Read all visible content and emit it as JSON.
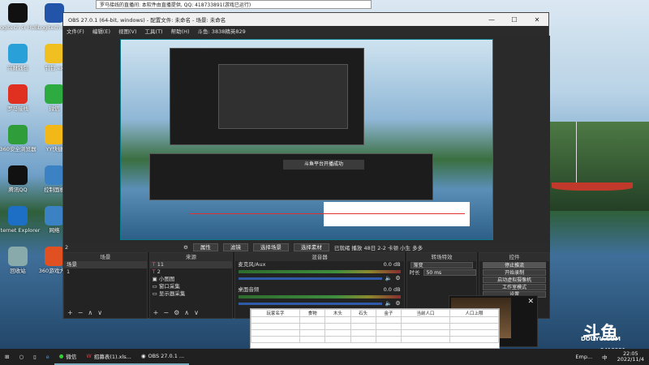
{
  "desktop": {
    "icons": [
      {
        "label": "Logitech G HUB",
        "color": "#111"
      },
      {
        "label": "Logitech G...",
        "color": "#2255aa"
      },
      {
        "label": "兴财钱包",
        "color": "#2aa0d8"
      },
      {
        "label": "钉钉.ex",
        "color": "#f0c020"
      },
      {
        "label": "罗马接线",
        "color": "#e03020"
      },
      {
        "label": "微信",
        "color": "#2daa40"
      },
      {
        "label": "360安全浏览器",
        "color": "#2f9e3a"
      },
      {
        "label": "YY快捷",
        "color": "#f2b818"
      },
      {
        "label": "腾讯QQ",
        "color": "#111"
      },
      {
        "label": "控制面板",
        "color": "#3b82c4"
      },
      {
        "label": "Internet Explorer",
        "color": "#1c6fc4"
      },
      {
        "label": "网络",
        "color": "#3b82c4"
      },
      {
        "label": "回收站",
        "color": "#8aa"
      },
      {
        "label": "360游戏大厅",
        "color": "#e05020"
      }
    ],
    "watermark": "DOUYU.COM",
    "room_id": "9418991"
  },
  "top_banner": "罗马接线的直播间: 本软件由直播提供, QQ: 418733891(游戏已运行)",
  "obs": {
    "title": "OBS 27.0.1 (64-bit, windows) - 配置文件: 未命名 - 场景: 未命名",
    "menu": [
      "文件(F)",
      "编辑(E)",
      "视图(V)",
      "工具(T)",
      "帮助(H)",
      "斗鱼: 3838精英829"
    ],
    "nested_text": "斗鱼平台开播成功",
    "toolbar": {
      "properties": "属性",
      "filters": "滤镜",
      "switch_scene": "选择场景",
      "choose_source": "选择素材",
      "status": "已就绪 播放 48日 2-2 卡顿 小生 多多"
    },
    "scene_label": "2",
    "docks": {
      "scenes": {
        "title": "场景",
        "items": [
          "场景",
          "1"
        ]
      },
      "sources": {
        "title": "来源",
        "items": [
          "11",
          "2",
          "小图图",
          "窗口采集",
          "显示器采集"
        ]
      },
      "mixer": {
        "title": "混音器",
        "channels": [
          {
            "name": "麦克风/Aux",
            "db": "0.0 dB"
          },
          {
            "name": "桌面音频",
            "db": "0.0 dB"
          }
        ]
      },
      "transitions": {
        "title": "转场特效",
        "selected": "渐变",
        "duration_label": "时长",
        "duration": "50 ms"
      },
      "controls": {
        "title": "控件",
        "buttons": [
          "停止推流",
          "开始录制",
          "启动虚拟摄像机",
          "工作室模式",
          "设置"
        ]
      }
    }
  },
  "sheet": {
    "headers": [
      "玩家名字",
      "食物",
      "木头",
      "石头",
      "金子",
      "当前人口",
      "人口上限"
    ]
  },
  "taskbar": {
    "items": [
      "微信",
      "招募表(1).xls...",
      "OBS 27.0.1 ...",
      "Emp..."
    ],
    "time": "22:05",
    "date": "2022/11/4",
    "lang": "中"
  }
}
